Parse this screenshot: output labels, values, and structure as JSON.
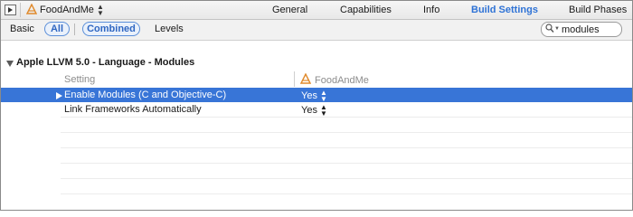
{
  "colors": {
    "accent": "#2f73d6",
    "selection": "#3875d7",
    "pill_border": "#5b8fd9"
  },
  "topbar": {
    "sidebar_toggle_icon": "sidebar-toggle-icon",
    "target_name": "FoodAndMe",
    "target_icon": "app-target-icon",
    "tabs": [
      {
        "label": "General",
        "active": false
      },
      {
        "label": "Capabilities",
        "active": false
      },
      {
        "label": "Info",
        "active": false
      },
      {
        "label": "Build Settings",
        "active": true
      },
      {
        "label": "Build Phases",
        "active": false
      }
    ]
  },
  "filterbar": {
    "basic": "Basic",
    "all": "All",
    "combined": "Combined",
    "levels": "Levels",
    "search": {
      "value": "modules",
      "icon": "search-icon"
    }
  },
  "section": {
    "title": "Apple LLVM 5.0 - Language - Modules",
    "column_setting": "Setting",
    "column_target": "FoodAndMe",
    "rows": [
      {
        "label": "Enable Modules (C and Objective-C)",
        "value": "Yes",
        "selected": true
      },
      {
        "label": "Link Frameworks Automatically",
        "value": "Yes",
        "selected": false
      }
    ]
  }
}
